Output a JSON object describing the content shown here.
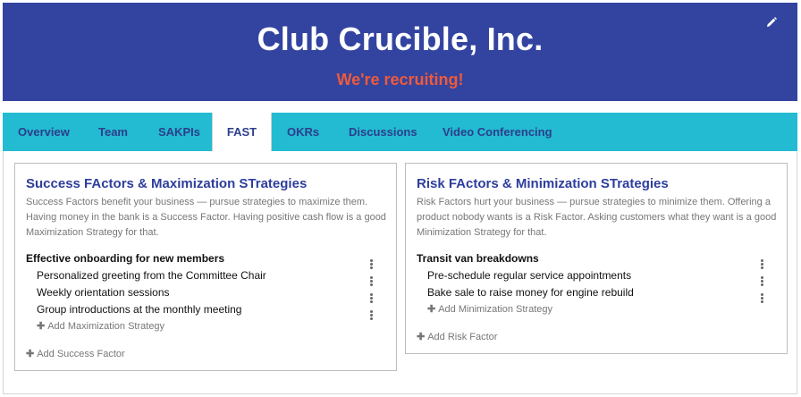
{
  "header": {
    "club_name": "Club Crucible, Inc.",
    "tagline": "We're recruiting!",
    "edit_icon": "pencil-icon",
    "banner_color": "#3344a0",
    "tagline_color": "#ef5a3a"
  },
  "tabs": [
    {
      "label": "Overview",
      "active": false
    },
    {
      "label": "Team",
      "active": false
    },
    {
      "label": "SAKPIs",
      "active": false
    },
    {
      "label": "FAST",
      "active": true
    },
    {
      "label": "OKRs",
      "active": false
    },
    {
      "label": "Discussions",
      "active": false
    },
    {
      "label": "Video Conferencing",
      "active": false
    }
  ],
  "success": {
    "title": "Success FActors & Maximization STrategies",
    "description": "Success Factors benefit your business — pursue strategies to maximize them. Having money in the bank is a Success Factor. Having positive cash flow is a good Maximization Strategy for that.",
    "factor": "Effective onboarding for new members",
    "strategies": [
      "Personalized greeting from the Committee Chair",
      "Weekly orientation sessions",
      "Group introductions at the monthly meeting"
    ],
    "add_strategy": "Add Maximization Strategy",
    "add_factor": "Add Success Factor"
  },
  "risk": {
    "title": "Risk FActors & Minimization STrategies",
    "description": "Risk Factors hurt your business — pursue strategies to minimize them. Offering a product nobody wants is a Risk Factor. Asking customers what they want is a good Minimization Strategy for that.",
    "factor": "Transit van breakdowns",
    "strategies": [
      "Pre-schedule regular service appointments",
      "Bake sale to raise money for engine rebuild"
    ],
    "add_strategy": "Add Minimization Strategy",
    "add_factor": "Add Risk Factor"
  }
}
